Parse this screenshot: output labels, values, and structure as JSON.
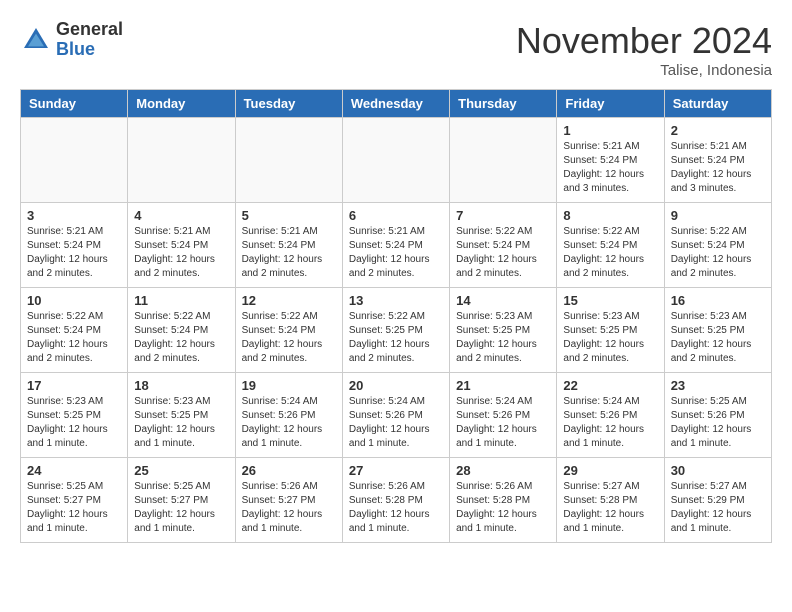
{
  "logo": {
    "general": "General",
    "blue": "Blue"
  },
  "title": "November 2024",
  "location": "Talise, Indonesia",
  "days_of_week": [
    "Sunday",
    "Monday",
    "Tuesday",
    "Wednesday",
    "Thursday",
    "Friday",
    "Saturday"
  ],
  "weeks": [
    [
      {
        "day": "",
        "info": ""
      },
      {
        "day": "",
        "info": ""
      },
      {
        "day": "",
        "info": ""
      },
      {
        "day": "",
        "info": ""
      },
      {
        "day": "",
        "info": ""
      },
      {
        "day": "1",
        "info": "Sunrise: 5:21 AM\nSunset: 5:24 PM\nDaylight: 12 hours\nand 3 minutes."
      },
      {
        "day": "2",
        "info": "Sunrise: 5:21 AM\nSunset: 5:24 PM\nDaylight: 12 hours\nand 3 minutes."
      }
    ],
    [
      {
        "day": "3",
        "info": "Sunrise: 5:21 AM\nSunset: 5:24 PM\nDaylight: 12 hours\nand 2 minutes."
      },
      {
        "day": "4",
        "info": "Sunrise: 5:21 AM\nSunset: 5:24 PM\nDaylight: 12 hours\nand 2 minutes."
      },
      {
        "day": "5",
        "info": "Sunrise: 5:21 AM\nSunset: 5:24 PM\nDaylight: 12 hours\nand 2 minutes."
      },
      {
        "day": "6",
        "info": "Sunrise: 5:21 AM\nSunset: 5:24 PM\nDaylight: 12 hours\nand 2 minutes."
      },
      {
        "day": "7",
        "info": "Sunrise: 5:22 AM\nSunset: 5:24 PM\nDaylight: 12 hours\nand 2 minutes."
      },
      {
        "day": "8",
        "info": "Sunrise: 5:22 AM\nSunset: 5:24 PM\nDaylight: 12 hours\nand 2 minutes."
      },
      {
        "day": "9",
        "info": "Sunrise: 5:22 AM\nSunset: 5:24 PM\nDaylight: 12 hours\nand 2 minutes."
      }
    ],
    [
      {
        "day": "10",
        "info": "Sunrise: 5:22 AM\nSunset: 5:24 PM\nDaylight: 12 hours\nand 2 minutes."
      },
      {
        "day": "11",
        "info": "Sunrise: 5:22 AM\nSunset: 5:24 PM\nDaylight: 12 hours\nand 2 minutes."
      },
      {
        "day": "12",
        "info": "Sunrise: 5:22 AM\nSunset: 5:24 PM\nDaylight: 12 hours\nand 2 minutes."
      },
      {
        "day": "13",
        "info": "Sunrise: 5:22 AM\nSunset: 5:25 PM\nDaylight: 12 hours\nand 2 minutes."
      },
      {
        "day": "14",
        "info": "Sunrise: 5:23 AM\nSunset: 5:25 PM\nDaylight: 12 hours\nand 2 minutes."
      },
      {
        "day": "15",
        "info": "Sunrise: 5:23 AM\nSunset: 5:25 PM\nDaylight: 12 hours\nand 2 minutes."
      },
      {
        "day": "16",
        "info": "Sunrise: 5:23 AM\nSunset: 5:25 PM\nDaylight: 12 hours\nand 2 minutes."
      }
    ],
    [
      {
        "day": "17",
        "info": "Sunrise: 5:23 AM\nSunset: 5:25 PM\nDaylight: 12 hours\nand 1 minute."
      },
      {
        "day": "18",
        "info": "Sunrise: 5:23 AM\nSunset: 5:25 PM\nDaylight: 12 hours\nand 1 minute."
      },
      {
        "day": "19",
        "info": "Sunrise: 5:24 AM\nSunset: 5:26 PM\nDaylight: 12 hours\nand 1 minute."
      },
      {
        "day": "20",
        "info": "Sunrise: 5:24 AM\nSunset: 5:26 PM\nDaylight: 12 hours\nand 1 minute."
      },
      {
        "day": "21",
        "info": "Sunrise: 5:24 AM\nSunset: 5:26 PM\nDaylight: 12 hours\nand 1 minute."
      },
      {
        "day": "22",
        "info": "Sunrise: 5:24 AM\nSunset: 5:26 PM\nDaylight: 12 hours\nand 1 minute."
      },
      {
        "day": "23",
        "info": "Sunrise: 5:25 AM\nSunset: 5:26 PM\nDaylight: 12 hours\nand 1 minute."
      }
    ],
    [
      {
        "day": "24",
        "info": "Sunrise: 5:25 AM\nSunset: 5:27 PM\nDaylight: 12 hours\nand 1 minute."
      },
      {
        "day": "25",
        "info": "Sunrise: 5:25 AM\nSunset: 5:27 PM\nDaylight: 12 hours\nand 1 minute."
      },
      {
        "day": "26",
        "info": "Sunrise: 5:26 AM\nSunset: 5:27 PM\nDaylight: 12 hours\nand 1 minute."
      },
      {
        "day": "27",
        "info": "Sunrise: 5:26 AM\nSunset: 5:28 PM\nDaylight: 12 hours\nand 1 minute."
      },
      {
        "day": "28",
        "info": "Sunrise: 5:26 AM\nSunset: 5:28 PM\nDaylight: 12 hours\nand 1 minute."
      },
      {
        "day": "29",
        "info": "Sunrise: 5:27 AM\nSunset: 5:28 PM\nDaylight: 12 hours\nand 1 minute."
      },
      {
        "day": "30",
        "info": "Sunrise: 5:27 AM\nSunset: 5:29 PM\nDaylight: 12 hours\nand 1 minute."
      }
    ]
  ]
}
